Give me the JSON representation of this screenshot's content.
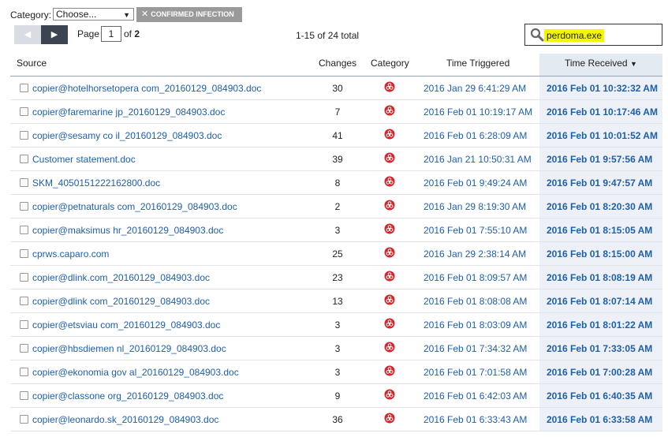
{
  "filter": {
    "category_label": "Category:",
    "category_value": "Choose...",
    "tag_label": "CONFIRMED INFECTION"
  },
  "pager": {
    "prev": "◀",
    "next": "▶",
    "page_label": "Page",
    "page_value": "1",
    "of_label": "of",
    "total_pages": "2",
    "count": "1-15 of 24 total"
  },
  "search": {
    "value": "perdoma.exe"
  },
  "table": {
    "headers": {
      "source": "Source",
      "changes": "Changes",
      "category": "Category",
      "triggered": "Time Triggered",
      "received": "Time Received"
    },
    "rows": [
      {
        "source": "copier@hotelhorsetopera com_20160129_084903.doc",
        "changes": "30",
        "triggered": "2016 Jan 29 6:41:29 AM",
        "received": "2016 Feb 01 10:32:32 AM"
      },
      {
        "source": "copier@faremarine jp_20160129_084903.doc",
        "changes": "7",
        "triggered": "2016 Feb 01 10:19:17 AM",
        "received": "2016 Feb 01 10:17:46 AM"
      },
      {
        "source": "copier@sesamy co il_20160129_084903.doc",
        "changes": "41",
        "triggered": "2016 Feb 01 6:28:09 AM",
        "received": "2016 Feb 01 10:01:52 AM"
      },
      {
        "source": "Customer statement.doc",
        "changes": "39",
        "triggered": "2016 Jan 21 10:50:31 AM",
        "received": "2016 Feb 01 9:57:56 AM"
      },
      {
        "source": "SKM_4050151222162800.doc",
        "changes": "8",
        "triggered": "2016 Feb 01 9:49:24 AM",
        "received": "2016 Feb 01 9:47:57 AM"
      },
      {
        "source": "copier@petnaturals com_20160129_084903.doc",
        "changes": "2",
        "triggered": "2016 Jan 29 8:19:30 AM",
        "received": "2016 Feb 01 8:20:30 AM"
      },
      {
        "source": "copier@maksimus hr_20160129_084903.doc",
        "changes": "3",
        "triggered": "2016 Feb 01 7:55:10 AM",
        "received": "2016 Feb 01 8:15:05 AM"
      },
      {
        "source": "cprws.caparo.com",
        "changes": "25",
        "triggered": "2016 Jan 29 2:38:14 AM",
        "received": "2016 Feb 01 8:15:00 AM"
      },
      {
        "source": "copier@dlink.com_20160129_084903.doc",
        "changes": "23",
        "triggered": "2016 Feb 01 8:09:57 AM",
        "received": "2016 Feb 01 8:08:19 AM"
      },
      {
        "source": "copier@dlink com_20160129_084903.doc",
        "changes": "13",
        "triggered": "2016 Feb 01 8:08:08 AM",
        "received": "2016 Feb 01 8:07:14 AM"
      },
      {
        "source": "copier@etsviau com_20160129_084903.doc",
        "changes": "3",
        "triggered": "2016 Feb 01 8:03:09 AM",
        "received": "2016 Feb 01 8:01:22 AM"
      },
      {
        "source": "copier@hbsdiemen nl_20160129_084903.doc",
        "changes": "3",
        "triggered": "2016 Feb 01 7:34:32 AM",
        "received": "2016 Feb 01 7:33:05 AM"
      },
      {
        "source": "copier@ekonomia gov al_20160129_084903.doc",
        "changes": "3",
        "triggered": "2016 Feb 01 7:01:58 AM",
        "received": "2016 Feb 01 7:00:28 AM"
      },
      {
        "source": "copier@classone org_20160129_084903.doc",
        "changes": "9",
        "triggered": "2016 Feb 01 6:42:03 AM",
        "received": "2016 Feb 01 6:40:35 AM"
      },
      {
        "source": "copier@leonardo.sk_20160129_084903.doc",
        "changes": "36",
        "triggered": "2016 Feb 01 6:33:43 AM",
        "received": "2016 Feb 01 6:33:58 AM"
      }
    ]
  },
  "icons": {
    "category": "biohazard-icon",
    "search": "search-icon",
    "sort": "sort-desc-icon"
  },
  "colors": {
    "link": "#1f5fa8",
    "category_icon": "#d4252b",
    "search_highlight": "#f5f500",
    "sorted_column_bg": "#edf1f7"
  }
}
